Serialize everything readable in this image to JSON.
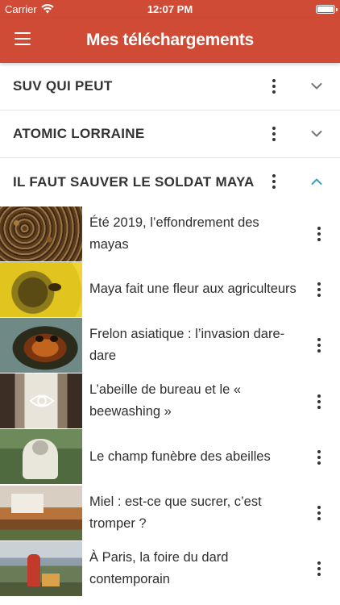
{
  "status_bar": {
    "carrier": "Carrier",
    "time": "12:07 PM"
  },
  "nav": {
    "title": "Mes téléchargements"
  },
  "sections": [
    {
      "title": "SUV QUI PEUT",
      "expanded": false
    },
    {
      "title": "ATOMIC LORRAINE",
      "expanded": false
    },
    {
      "title": "IL FAUT SAUVER LE SOLDAT MAYA",
      "expanded": true
    }
  ],
  "episodes": [
    {
      "title": "Été 2019, l’effondrement des mayas",
      "thumb": "bees-swarm"
    },
    {
      "title": "Maya fait une fleur aux agriculteurs",
      "thumb": "sunflower-bee"
    },
    {
      "title": "Frelon asiatique : l’invasion dare-dare",
      "thumb": "hornet"
    },
    {
      "title": "L’abeille de bureau et le « beewashing »",
      "thumb": "office-corridor"
    },
    {
      "title": "Le champ funèbre des abeilles",
      "thumb": "beekeeper"
    },
    {
      "title": "Miel : est-ce que sucrer, c’est tromper ?",
      "thumb": "honey-frames"
    },
    {
      "title": "À Paris, la foire du dard contemporain",
      "thumb": "rooftop-hives"
    }
  ],
  "colors": {
    "brand": "#cf4b36",
    "accent_chevron": "#3aa0c8",
    "text": "#2f2f2f"
  },
  "icons": {
    "menu": "hamburger-icon",
    "more": "kebab-icon",
    "collapse": "chevron-down-icon",
    "expand": "chevron-up-icon",
    "wifi": "wifi-icon",
    "battery": "battery-icon"
  }
}
